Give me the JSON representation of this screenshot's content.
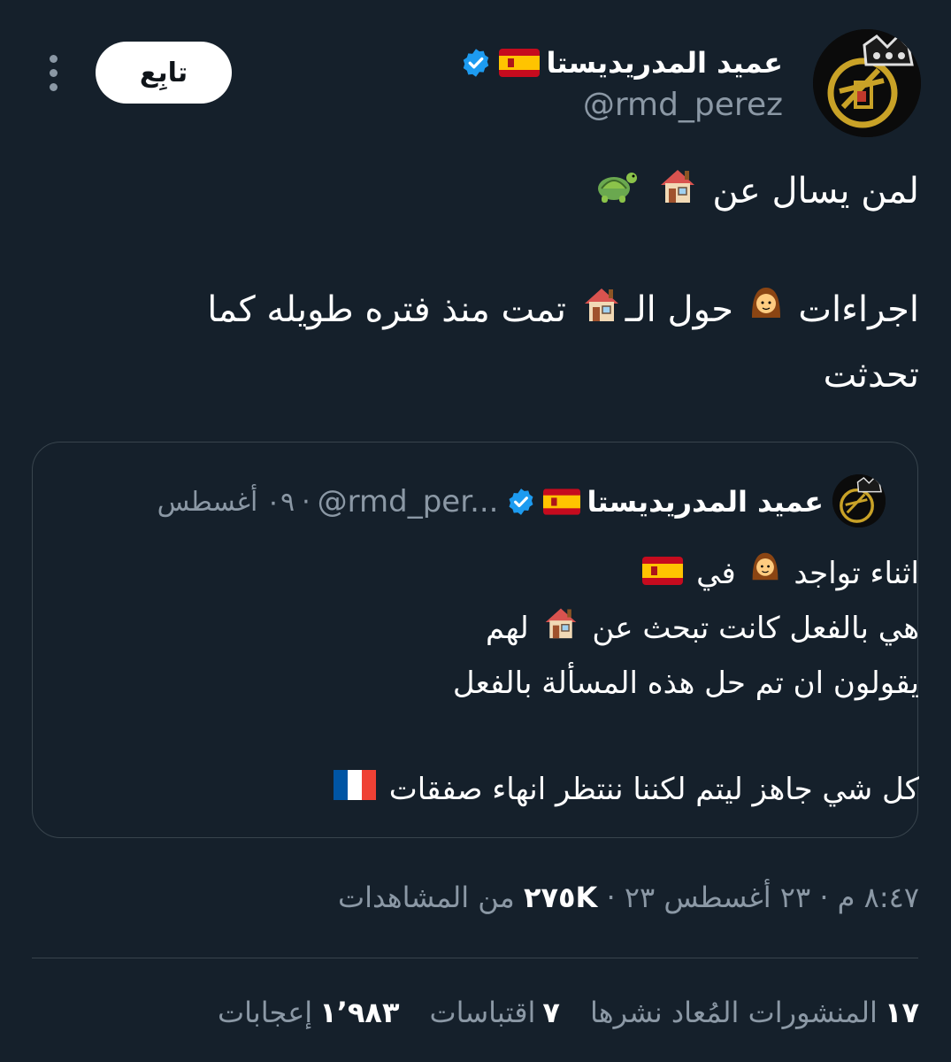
{
  "author": {
    "display_name": "عميد المدريديستا",
    "handle": "@rmd_perez",
    "flag": "🇪🇸",
    "verified_icon": "verified-badge-icon",
    "avatar_icon": "real-madrid-crest-icon"
  },
  "actions": {
    "follow_label": "تابِع",
    "more_icon": "more-vertical-icon"
  },
  "tweet": {
    "line1_text": "لمن يسال عن",
    "line1_emojis": [
      "house-icon",
      "turtle-icon"
    ],
    "line2_part1": "اجراءات",
    "line2_part2": "حول الـ",
    "line2_part3": "تمت منذ فتره طويله كما",
    "line3": "تحدثت"
  },
  "quote": {
    "display_name": "عميد المدريديستا",
    "handle": "@rmd_per...",
    "separator": "·",
    "date": "٠٩ أغسطس",
    "line1_part1": "اثناء تواجد",
    "line1_part2": "في",
    "line2_part1": "هي بالفعل كانت تبحث عن",
    "line2_part2": "لهم",
    "line3": "يقولون ان تم حل هذه المسألة بالفعل",
    "line4": "كل شي جاهز ليتم لكننا ننتظر انهاء صفقات",
    "line4_flag": "🇫🇷"
  },
  "meta": {
    "time": "٨:٤٧ م",
    "separator": "·",
    "date": "٢٣ أغسطس ٢٣",
    "views_count": "٢٧٥K",
    "views_label": "من المشاهدات"
  },
  "stats": {
    "reposts_count": "١٧",
    "reposts_label": "المنشورات المُعاد نشرها",
    "quotes_count": "٧",
    "quotes_label": "اقتباسات",
    "likes_count": "١٬٩٨٣",
    "likes_label": "إعجابات"
  },
  "colors": {
    "background": "#15202b",
    "secondary_text": "#8b98a5",
    "border": "#38444d",
    "verified_blue": "#1d9bf0"
  }
}
